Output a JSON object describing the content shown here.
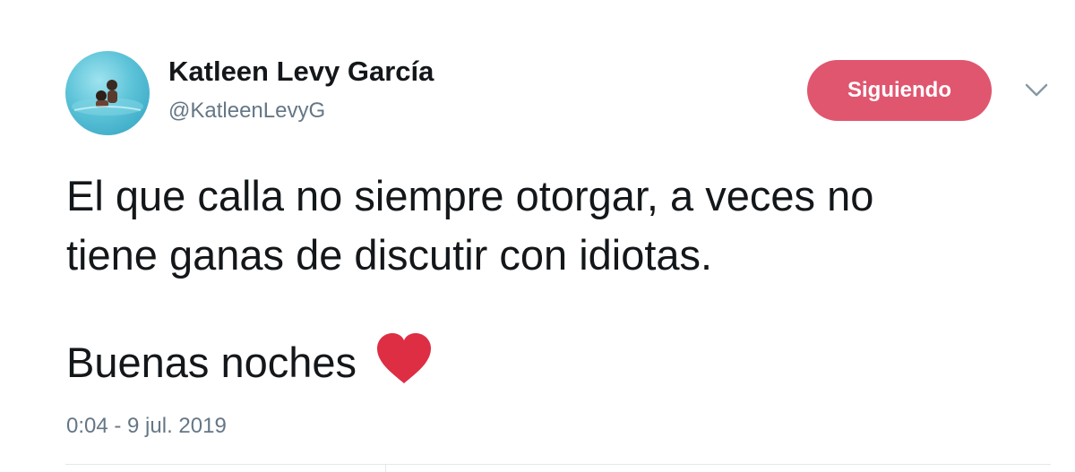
{
  "author": {
    "display_name": "Katleen Levy García",
    "handle": "@KatleenLevyG",
    "avatar_icon": "avatar-photo"
  },
  "follow_button": {
    "label": "Siguiendo",
    "color": "#e0566f"
  },
  "menu_icon": "chevron-down-icon",
  "tweet": {
    "text": "El que calla no siempre otorgar, a veces no\ntiene ganas de discutir con idiotas.",
    "greeting": "Buenas noches",
    "emoji_icon": "red-heart-icon",
    "heart_color": "#dd2e44",
    "timestamp": "0:04 - 9 jul. 2019"
  }
}
